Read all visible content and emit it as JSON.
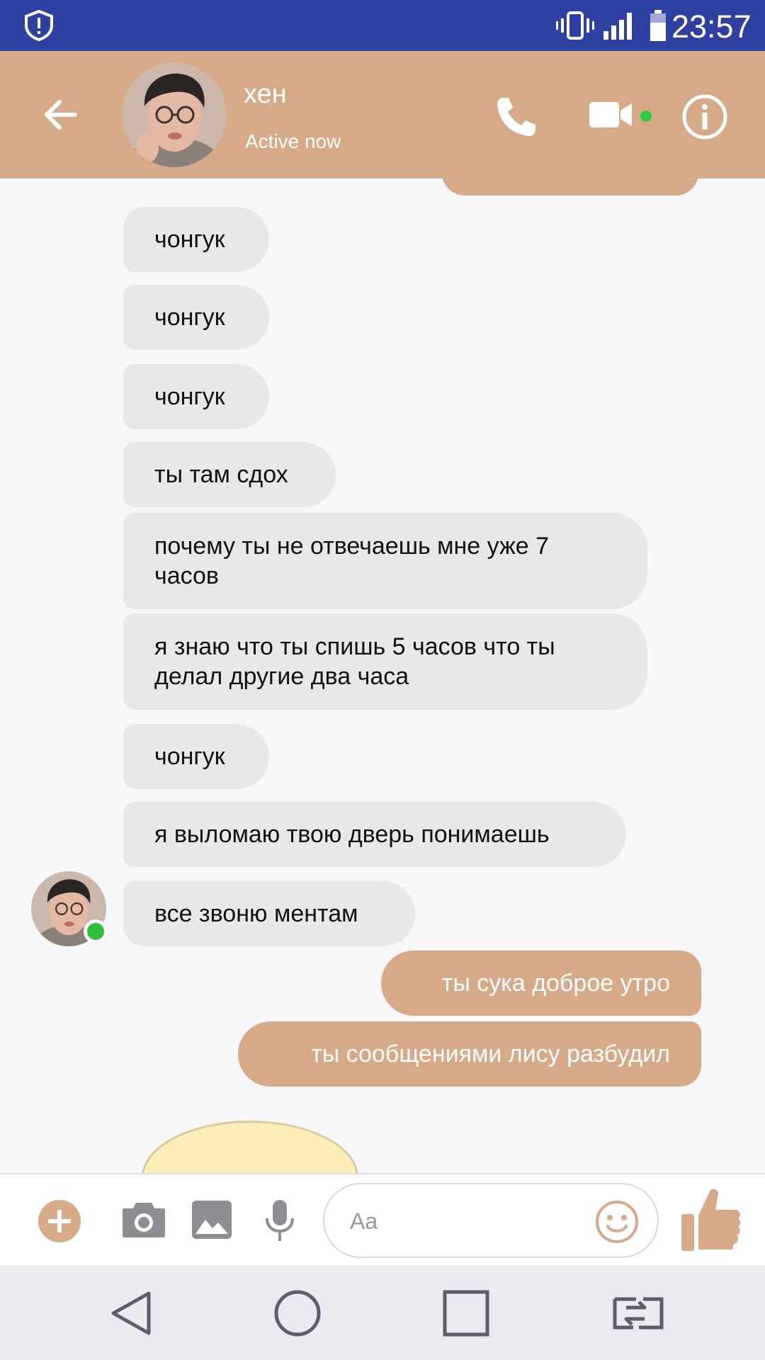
{
  "status_bar": {
    "time": "23:57",
    "icons": [
      "shield-icon",
      "vibrate-icon",
      "signal-icon",
      "battery-icon"
    ]
  },
  "header": {
    "contact_name": "хен",
    "status": "Active now",
    "icons": [
      "back-arrow-icon",
      "phone-icon",
      "video-camera-icon",
      "info-icon"
    ],
    "accent_color": "#d6aa89"
  },
  "messages": [
    {
      "from": "contact",
      "text": "чонгук"
    },
    {
      "from": "contact",
      "text": "чонгук"
    },
    {
      "from": "contact",
      "text": "чонгук"
    },
    {
      "from": "contact",
      "text": "ты там сдох"
    },
    {
      "from": "contact",
      "text": "почему ты не отвечаешь мне уже 7 часов"
    },
    {
      "from": "contact",
      "text": "я знаю что ты спишь 5 часов что ты делал другие два часа"
    },
    {
      "from": "contact",
      "text": "чонгук"
    },
    {
      "from": "contact",
      "text": "я выломаю твою дверь понимаешь"
    },
    {
      "from": "contact",
      "text": "все звоню ментам"
    },
    {
      "from": "me",
      "text": "ты сука доброе утро"
    },
    {
      "from": "me",
      "text": "ты сообщениями лису разбудил"
    }
  ],
  "composer": {
    "placeholder": "Aa",
    "icons": [
      "plus-icon",
      "camera-icon",
      "gallery-icon",
      "microphone-icon",
      "smiley-icon",
      "thumbs-up-icon"
    ]
  },
  "nav_bar": {
    "icons": [
      "nav-back-icon",
      "nav-home-icon",
      "nav-recents-icon",
      "nav-switch-icon"
    ]
  },
  "colors": {
    "status_bar": "#2e40a2",
    "incoming_bubble": "#e8e7ea",
    "outgoing_bubble": "#d6aa89",
    "online": "#2fcc40"
  }
}
